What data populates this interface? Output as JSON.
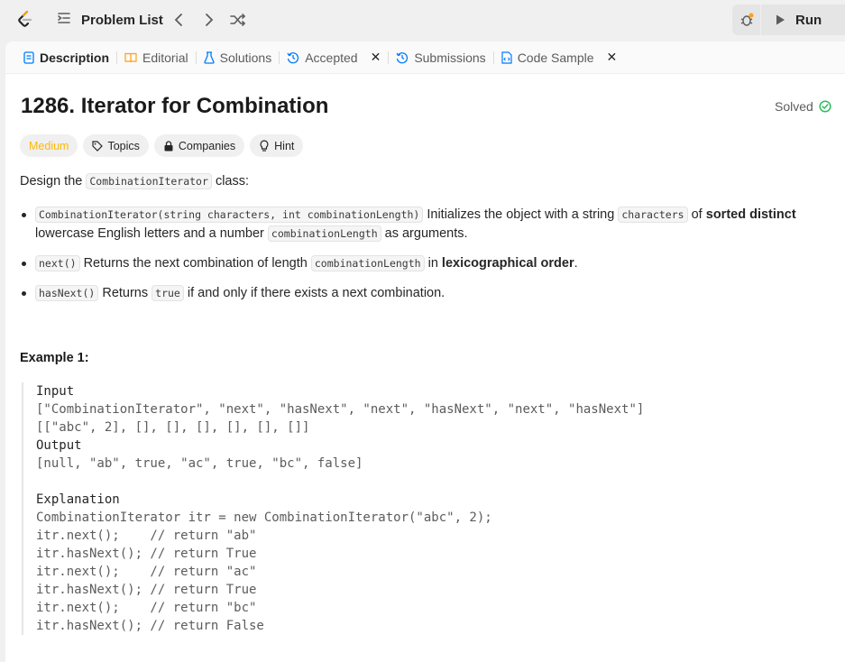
{
  "topbar": {
    "problem_list_label": "Problem List",
    "run_label": "Run"
  },
  "tabs": [
    {
      "label": "Description",
      "active": true,
      "closable": false,
      "icon": "document-icon"
    },
    {
      "label": "Editorial",
      "active": false,
      "closable": false,
      "icon": "book-icon"
    },
    {
      "label": "Solutions",
      "active": false,
      "closable": false,
      "icon": "flask-icon"
    },
    {
      "label": "Accepted",
      "active": false,
      "closable": true,
      "icon": "history-icon"
    },
    {
      "label": "Submissions",
      "active": false,
      "closable": false,
      "icon": "history-icon"
    },
    {
      "label": "Code Sample",
      "active": false,
      "closable": true,
      "icon": "code-file-icon"
    }
  ],
  "problem": {
    "title": "1286. Iterator for Combination",
    "status": "Solved",
    "difficulty": "Medium",
    "chips": [
      "Topics",
      "Companies",
      "Hint"
    ],
    "intro_before": "Design the ",
    "intro_code": "CombinationIterator",
    "intro_after": " class:",
    "b1_code1": "CombinationIterator(string characters, int combinationLength)",
    "b1_text1": " Initializes the object with a string ",
    "b1_code2": "characters",
    "b1_text2": " of ",
    "b1_bold": "sorted distinct",
    "b1_text3": " lowercase English letters and a number ",
    "b1_code3": "combinationLength",
    "b1_text4": " as arguments.",
    "b2_code1": "next()",
    "b2_text1": " Returns the next combination of length ",
    "b2_code2": "combinationLength",
    "b2_text2": " in ",
    "b2_bold": "lexicographical order",
    "b2_text3": ".",
    "b3_code1": "hasNext()",
    "b3_text1": " Returns ",
    "b3_code2": "true",
    "b3_text2": " if and only if there exists a next combination.",
    "example_title": "Example 1:",
    "example": {
      "input_label": "Input",
      "input_line1": "[\"CombinationIterator\", \"next\", \"hasNext\", \"next\", \"hasNext\", \"next\", \"hasNext\"]",
      "input_line2": "[[\"abc\", 2], [], [], [], [], [], []]",
      "output_label": "Output",
      "output_line": "[null, \"ab\", true, \"ac\", true, \"bc\", false]",
      "explanation_label": "Explanation",
      "lines": [
        "CombinationIterator itr = new CombinationIterator(\"abc\", 2);",
        "itr.next();    // return \"ab\"",
        "itr.hasNext(); // return True",
        "itr.next();    // return \"ac\"",
        "itr.hasNext(); // return True",
        "itr.next();    // return \"bc\"",
        "itr.hasNext(); // return False"
      ]
    }
  },
  "colors": {
    "medium": "#ffb800",
    "solved_green": "#2cbb5d",
    "accent_blue": "#007aff"
  }
}
